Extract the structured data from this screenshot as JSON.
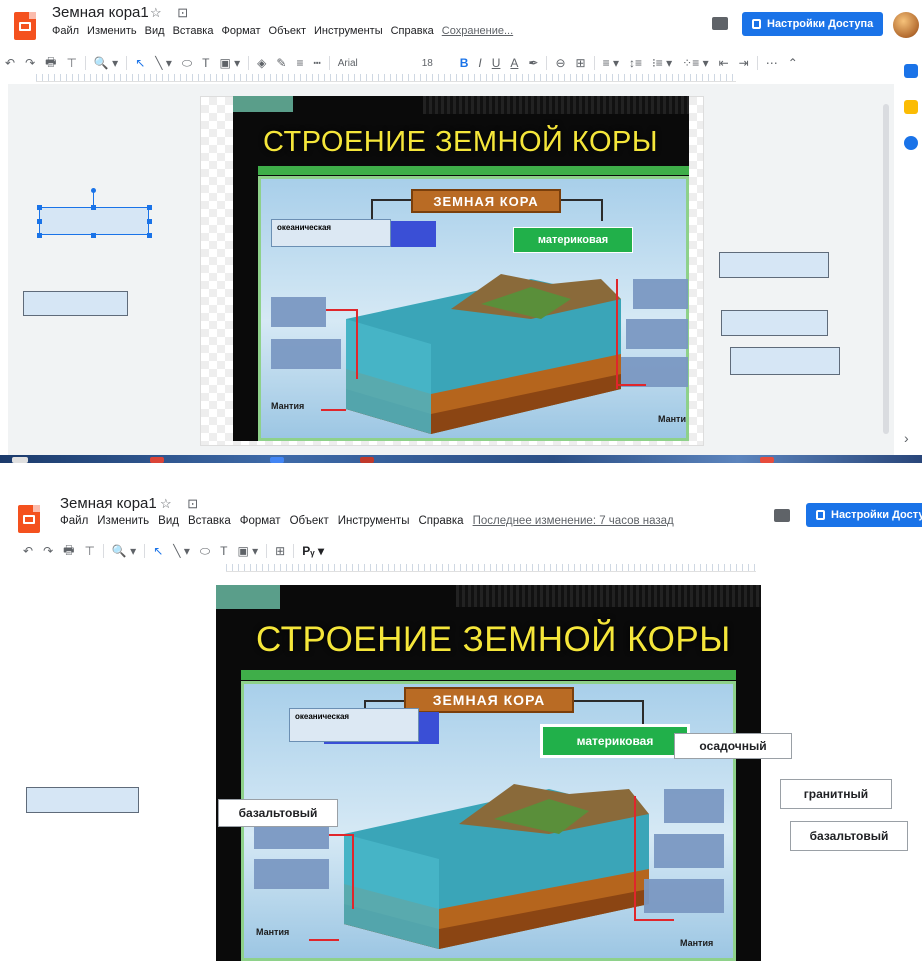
{
  "screen1": {
    "doc_title": "Земная кора1",
    "title_icons": "☆ ⊡",
    "menu": [
      "Файл",
      "Изменить",
      "Вид",
      "Вставка",
      "Формат",
      "Объект",
      "Инструменты",
      "Справка"
    ],
    "save_status": "Сохранение...",
    "share_label": "Настройки Доступа",
    "toolbar": {
      "undo": "↶",
      "redo": "↷",
      "print": "🖶",
      "paint": "⊤",
      "zoom": "🔍 ▾",
      "select": "↖",
      "line": "╲ ▾",
      "shape": "⬭",
      "textbox": "T",
      "image": "▣ ▾",
      "fill": "◈",
      "border_color": "✎",
      "border_weight": "≡",
      "border_dash": "┅",
      "font": "Arial",
      "font_size": "18",
      "bold": "B",
      "italic": "I",
      "underline": "U",
      "text_color": "A",
      "highlight": "✒",
      "link": "⊖",
      "comment": "⊞",
      "align": "≡ ▾",
      "line_spacing": "↕≡",
      "numbered": "⁝≡ ▾",
      "bulleted": "⁘≡ ▾",
      "indent_less": "⇤",
      "indent_more": "⇥",
      "more": "⋯",
      "collapse": "⌃"
    },
    "slide_title": "СТРОЕНИЕ ЗЕМНОЙ КОРЫ",
    "crust_label": "ЗЕМНАЯ КОРА",
    "oceanic_label": "океаническая",
    "continental_label": "материковая",
    "mantle_left": "Мантия",
    "mantle_right": "Манти",
    "side_chevron": "›"
  },
  "screen2": {
    "doc_title": "Земная кора1",
    "title_icons": "☆ ⊡",
    "menu": [
      "Файл",
      "Изменить",
      "Вид",
      "Вставка",
      "Формат",
      "Объект",
      "Инструменты",
      "Справка"
    ],
    "last_edit": "Последнее изменение: 7 часов назад",
    "share_label": "Настройки Досту",
    "toolbar": {
      "undo": "↶",
      "redo": "↷",
      "print": "🖶",
      "paint": "⊤",
      "zoom": "🔍 ▾",
      "select": "↖",
      "line": "╲ ▾",
      "shape": "⬭",
      "textbox": "T",
      "image": "▣ ▾",
      "comment": "⊞",
      "input": "Pᵧ ▾"
    },
    "slide_title": "СТРОЕНИЕ ЗЕМНОЙ КОРЫ",
    "crust_label": "ЗЕМНАЯ КОРА",
    "oceanic_label": "океаническая",
    "continental_label": "материковая",
    "mantle_left": "Мантия",
    "mantle_right": "Мантия",
    "words": {
      "sedimentary": "осадочный",
      "basalt_placed": "базальтовый",
      "granite": "гранитный",
      "basalt": "базальтовый"
    }
  }
}
